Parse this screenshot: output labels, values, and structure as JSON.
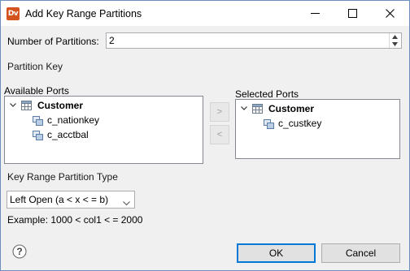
{
  "window": {
    "title": "Add Key Range Partitions",
    "app_icon_text": "Dv"
  },
  "partitions": {
    "label": "Number of  Partitions:",
    "value": "2"
  },
  "partition_key": {
    "label": "Partition Key"
  },
  "available_ports": {
    "label": "Available Ports",
    "table": "Customer",
    "columns": [
      "c_nationkey",
      "c_acctbal"
    ]
  },
  "move_buttons": {
    "add": ">",
    "remove": "<"
  },
  "selected_ports": {
    "label": "Selected Ports",
    "table": "Customer",
    "columns": [
      "c_custkey"
    ]
  },
  "range_type": {
    "label": "Key Range Partition Type",
    "selected": "Left Open (a < x < = b)",
    "example": "Example: 1000 < col1 < = 2000"
  },
  "footer": {
    "help_glyph": "?",
    "ok": "OK",
    "cancel": "Cancel"
  },
  "colors": {
    "app_icon": "#d4531c",
    "default_button_border": "#0078d7",
    "dialog_background": "#f0f0f0"
  }
}
